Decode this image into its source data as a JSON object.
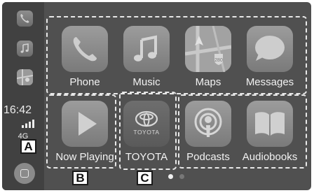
{
  "sidebar": {
    "recent_apps": [
      {
        "name": "phone-icon"
      },
      {
        "name": "music-icon"
      },
      {
        "name": "maps-icon"
      }
    ],
    "time": "16:42",
    "network": "4G",
    "home_icon": "home-button-icon"
  },
  "apps": [
    {
      "label": "Phone",
      "icon": "phone-icon"
    },
    {
      "label": "Music",
      "icon": "music-icon"
    },
    {
      "label": "Maps",
      "icon": "maps-icon"
    },
    {
      "label": "Messages",
      "icon": "messages-icon"
    },
    {
      "label": "Now Playing",
      "icon": "play-icon"
    },
    {
      "label": "TOYOTA",
      "icon": "toyota-icon",
      "logo_text": "TOYOTA"
    },
    {
      "label": "Podcasts",
      "icon": "podcasts-icon"
    },
    {
      "label": "Audiobooks",
      "icon": "book-icon"
    }
  ],
  "callouts": {
    "a": "A",
    "b": "B",
    "c": "C"
  },
  "page_indicator": {
    "pages": 2,
    "current": 1
  },
  "colors": {
    "screen": "#505050",
    "sidebar": "#414141",
    "text": "#f2f2f2",
    "tile": "#8c8c8c"
  }
}
